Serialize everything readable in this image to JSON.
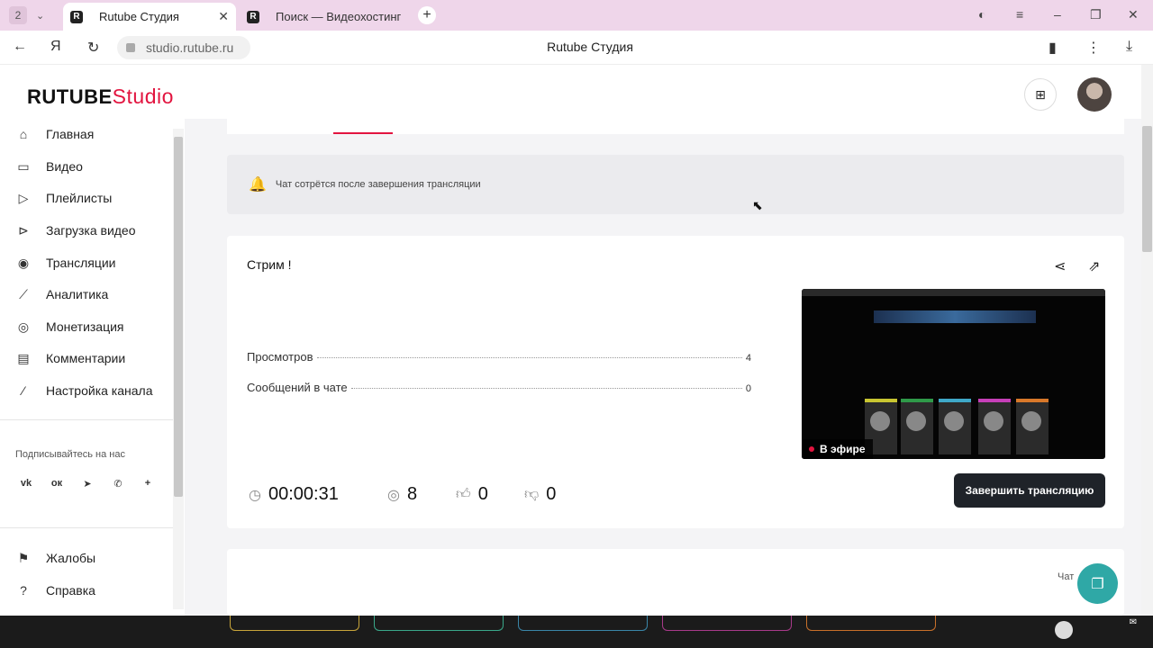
{
  "browser": {
    "tab_count": "2",
    "tabs": [
      {
        "title": "Rutube Студия",
        "favicon": "R"
      },
      {
        "title": "Поиск — Видеохостинг R",
        "favicon": "R"
      }
    ],
    "url": "studio.rutube.ru",
    "page_title": "Rutube Студия"
  },
  "app": {
    "logo_main": "RUTUBE",
    "logo_accent": "Studio",
    "brand_color": "#e2143f"
  },
  "sidebar": {
    "items": [
      {
        "label": "Главная",
        "icon": "home-icon"
      },
      {
        "label": "Видео",
        "icon": "video-icon"
      },
      {
        "label": "Плейлисты",
        "icon": "playlist-icon"
      },
      {
        "label": "Загрузка видео",
        "icon": "upload-icon"
      },
      {
        "label": "Трансляции",
        "icon": "broadcast-icon"
      },
      {
        "label": "Аналитика",
        "icon": "analytics-icon"
      },
      {
        "label": "Монетизация",
        "icon": "monetization-icon"
      },
      {
        "label": "Комментарии",
        "icon": "comments-icon"
      },
      {
        "label": "Настройка канала",
        "icon": "wand-icon"
      }
    ],
    "follow_label": "Подписывайтесь на нас",
    "bottom_items": [
      {
        "label": "Жалобы",
        "icon": "flag-icon"
      },
      {
        "label": "Справка",
        "icon": "help-icon"
      }
    ]
  },
  "notice": {
    "text": "Чат сотрётся после завершения трансляции"
  },
  "stream": {
    "title": "Стрим !",
    "stats": [
      {
        "label": "Просмотров",
        "value": "4"
      },
      {
        "label": "Сообщений в чате",
        "value": "0"
      }
    ],
    "live_label": "В эфире",
    "duration": "00:00:31",
    "viewers": "8",
    "likes": "0",
    "dislikes": "0",
    "end_button": "Завершить трансляцию"
  },
  "chat": {
    "label": "Чат"
  }
}
